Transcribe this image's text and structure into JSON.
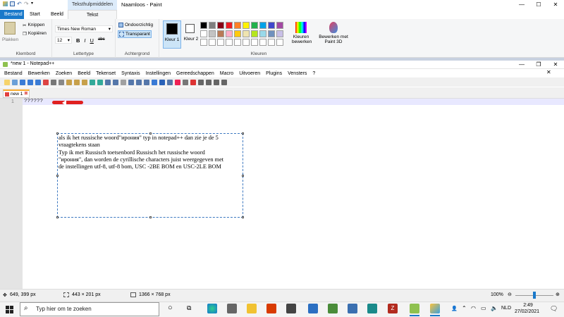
{
  "paint": {
    "title": "Naamloos - Paint",
    "context_tab_header": "Teksthulpmiddelen",
    "tabs": [
      "Bestand",
      "Start",
      "Beeld",
      "Tekst"
    ],
    "clipboard": {
      "paste": "Plakken",
      "cut": "Knippen",
      "copy": "Kopiëren",
      "group": "Klembord"
    },
    "font": {
      "family": "Times New Roman",
      "size": "12",
      "bold": "B",
      "italic": "I",
      "underline": "U",
      "strike": "abc",
      "group": "Lettertype"
    },
    "background": {
      "opaque": "Ondoorzichtig",
      "transparent": "Transparant",
      "group": "Achtergrond"
    },
    "colors": {
      "color1_label": "Kleur 1",
      "color2_label": "Kleur 2",
      "edit_colors": "Kleuren bewerken",
      "paint3d": "Bewerken met Paint 3D",
      "group": "Kleuren",
      "color1": "#000000",
      "color2": "#ffffff",
      "palette_row1": [
        "#000000",
        "#7f7f7f",
        "#880015",
        "#ed1c24",
        "#ff7f27",
        "#fff200",
        "#22b14c",
        "#00a2e8",
        "#3f48cc",
        "#a349a4"
      ],
      "palette_row2": [
        "#ffffff",
        "#c3c3c3",
        "#b97a57",
        "#ffaec9",
        "#ffc90e",
        "#efe4b0",
        "#b5e61d",
        "#99d9ea",
        "#7092be",
        "#c8bfe7"
      ]
    }
  },
  "notepad": {
    "title": "*new 1 - Notepad++",
    "menu": [
      "Bestand",
      "Bewerken",
      "Zoeken",
      "Beeld",
      "Tekenset",
      "Syntaxis",
      "Instellingen",
      "Gereedschappen",
      "Macro",
      "Uitvoeren",
      "Plugins",
      "Vensters",
      "?"
    ],
    "doc_tab": "new 1",
    "line_number": "1",
    "line_text": "??????"
  },
  "textbox": {
    "lines": [
      "als ik het russische woord\"ирония\" typ in notepad++ dan zie je de 5",
      "vraagtekens staan",
      "Typ ik met Russisch toetsenbord Russisch het russische woord",
      "\"ирония\", dan worden de cyrillische characters juist weergegeven met",
      "de instellingen  utf-8, utf-8 bom, USC -2BE BOM en USC-2LE BOM"
    ]
  },
  "status": {
    "cursor": "649, 399 px",
    "selection": "443 × 201 px",
    "canvas": "1366 × 768 px",
    "zoom": "100%",
    "zoom_fraction": 0.5
  },
  "taskbar": {
    "search_placeholder": "Typ hier om te zoeken",
    "language": "NLD",
    "time": "2:49",
    "date": "27/02/2021"
  }
}
